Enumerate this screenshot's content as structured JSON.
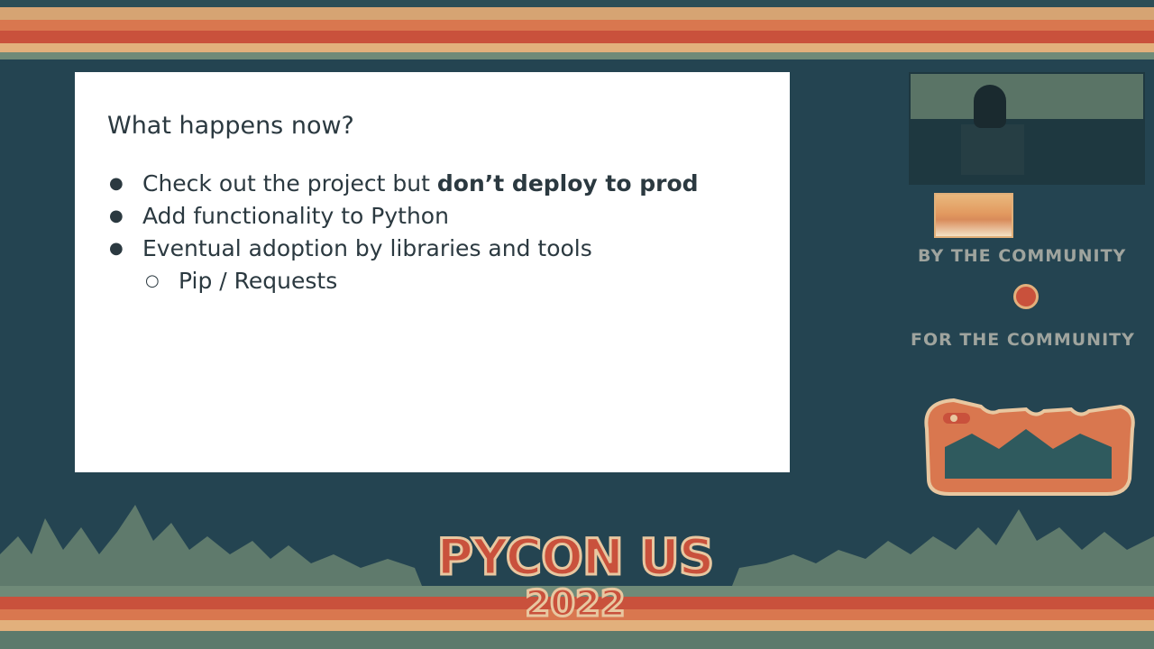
{
  "slide": {
    "title": "What happens now?",
    "bullets": [
      {
        "prefix": "Check out the project but ",
        "bold": "don’t deploy to prod"
      },
      {
        "text": "Add functionality to Python"
      },
      {
        "text": "Eventual adoption by libraries and tools"
      }
    ],
    "sub_bullets": [
      {
        "text": "Pip / Requests"
      }
    ],
    "bullet_glyph": "●",
    "sub_bullet_glyph": "○"
  },
  "branding": {
    "by_community": "BY THE COMMUNITY",
    "for_community": "FOR THE COMMUNITY",
    "event_name": "PYCON US",
    "event_year": "2022"
  },
  "colors": {
    "background": "#244451",
    "accent_red": "#c9513c",
    "accent_orange": "#d9774f",
    "accent_cream": "#e2b07c",
    "slide_text": "#2b3940"
  }
}
